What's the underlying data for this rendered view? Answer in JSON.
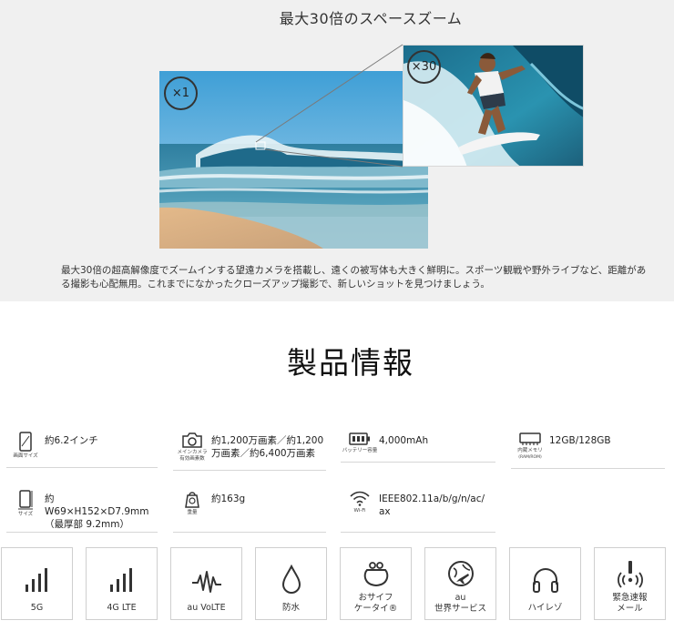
{
  "zoom": {
    "title": "最大30倍のスペースズーム",
    "badge_wide": "×1",
    "badge_zoom": "×30",
    "description_line1": "最大30倍の超高解像度でズームインする望遠カメラを搭載し、遠くの被写体も大きく鮮明に。スポーツ観戦や野外ライブなど、距離があ",
    "description_line2": "る撮影も心配無用。これまでになかったクローズアップ撮影で、新しいショットを見つけましょう。"
  },
  "specs": {
    "heading": "製品情報",
    "items": [
      {
        "icon": "screen-icon",
        "label": "画面サイズ",
        "value": "約6.2インチ"
      },
      {
        "icon": "camera-icon",
        "label_line1": "メインカメラ",
        "label_line2": "有効画素数",
        "value_line1": "約1,200万画素／約1,200",
        "value_line2": "万画素／約6,400万画素"
      },
      {
        "icon": "battery-icon",
        "label": "バッテリー容量",
        "value": "4,000mAh"
      },
      {
        "icon": "memory-icon",
        "label": "内蔵メモリ",
        "label_sub": "(RAM/ROM)",
        "value": "12GB/128GB"
      },
      {
        "icon": "size-icon",
        "label": "サイズ",
        "value_line1": "約W69×H152×D7.9mm",
        "value_line2": "（最厚部 9.2mm）"
      },
      {
        "icon": "weight-icon",
        "label": "重量",
        "value": "約163g"
      },
      {
        "icon": "wifi-icon",
        "label": "Wi-Fi",
        "value_line1": "IEEE802.11a/b/g/n/ac/",
        "value_line2": "ax"
      }
    ]
  },
  "features": [
    {
      "icon": "signal-bars-icon",
      "label": "5G"
    },
    {
      "icon": "signal-bars-icon",
      "label": "4G LTE"
    },
    {
      "icon": "volte-wave-icon",
      "label": "au VoLTE"
    },
    {
      "icon": "water-drop-icon",
      "label": "防水"
    },
    {
      "icon": "wallet-purse-icon",
      "label": "おサイフ\nケータイ®"
    },
    {
      "icon": "globe-plane-icon",
      "label": "au\n世界サービス"
    },
    {
      "icon": "headphones-icon",
      "label": "ハイレゾ"
    },
    {
      "icon": "emergency-alert-icon",
      "label": "緊急速報\nメール"
    }
  ]
}
